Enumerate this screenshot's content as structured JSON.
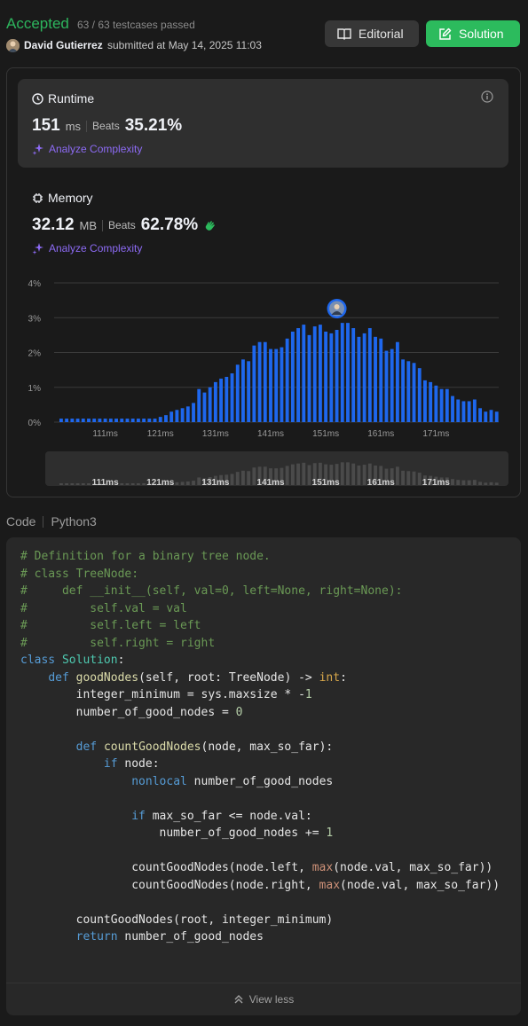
{
  "header": {
    "status": "Accepted",
    "testcases": "63 / 63 testcases passed",
    "user": "David Gutierrez",
    "submitted": "submitted at May 14, 2025 11:03",
    "editorial_label": "Editorial",
    "solution_label": "Solution"
  },
  "runtime": {
    "label": "Runtime",
    "value": "151",
    "unit": "ms",
    "beats_label": "Beats",
    "beats": "35.21%",
    "analyze": "Analyze Complexity"
  },
  "memory": {
    "label": "Memory",
    "value": "32.12",
    "unit": "MB",
    "beats_label": "Beats",
    "beats": "62.78%",
    "analyze": "Analyze Complexity"
  },
  "chart_data": {
    "type": "bar",
    "y_ticks": [
      "4%",
      "3%",
      "2%",
      "1%",
      "0%"
    ],
    "ylim": [
      0,
      4
    ],
    "x_ticks": [
      "111ms",
      "121ms",
      "131ms",
      "141ms",
      "151ms",
      "161ms",
      "171ms"
    ],
    "bar_color": "#1e67ed",
    "values": [
      0.1,
      0.1,
      0.1,
      0.1,
      0.1,
      0.1,
      0.1,
      0.1,
      0.1,
      0.1,
      0.1,
      0.1,
      0.1,
      0.1,
      0.1,
      0.1,
      0.1,
      0.1,
      0.15,
      0.2,
      0.3,
      0.35,
      0.4,
      0.45,
      0.55,
      0.95,
      0.85,
      1.0,
      1.15,
      1.25,
      1.3,
      1.4,
      1.65,
      1.8,
      1.75,
      2.2,
      2.3,
      2.3,
      2.1,
      2.1,
      2.15,
      2.4,
      2.6,
      2.7,
      2.8,
      2.5,
      2.75,
      2.8,
      2.6,
      2.55,
      2.65,
      2.85,
      2.85,
      2.7,
      2.45,
      2.55,
      2.7,
      2.45,
      2.4,
      2.05,
      2.1,
      2.3,
      1.8,
      1.75,
      1.7,
      1.55,
      1.2,
      1.15,
      1.05,
      0.95,
      0.95,
      0.75,
      0.65,
      0.6,
      0.6,
      0.65,
      0.4,
      0.3,
      0.35,
      0.3
    ],
    "user_bar_index": 50
  },
  "code_section": {
    "label": "Code",
    "language": "Python3",
    "view_less": "View less"
  }
}
